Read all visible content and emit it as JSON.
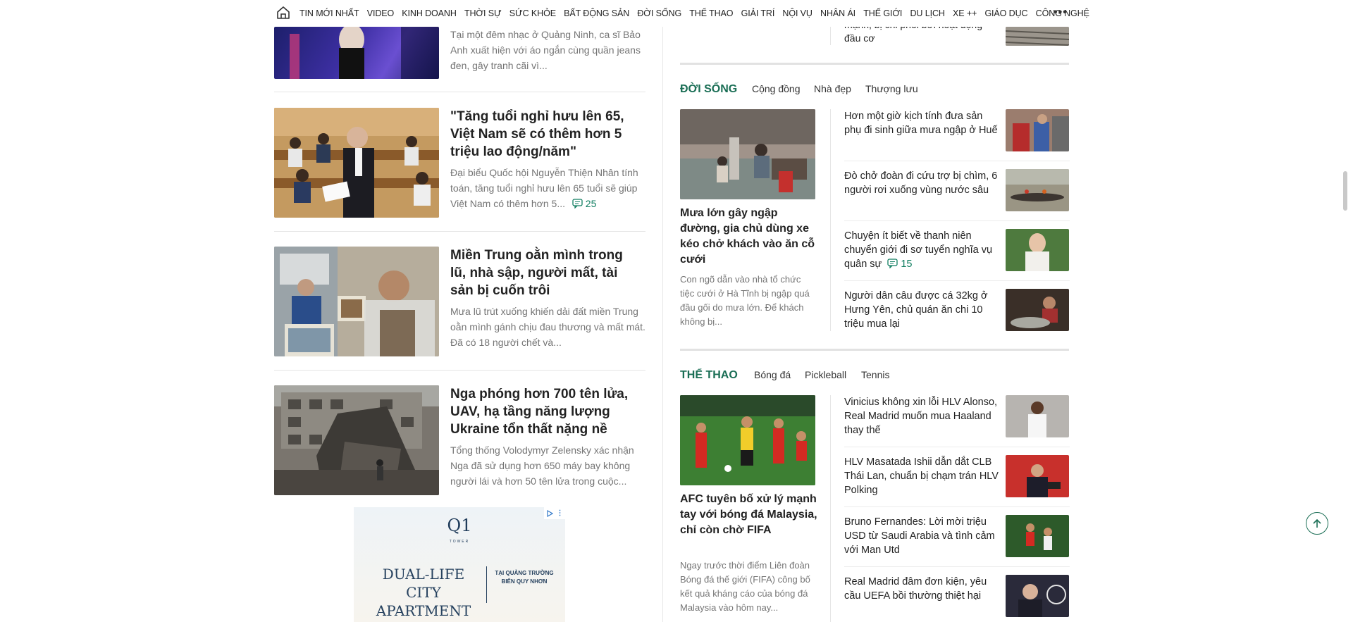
{
  "nav": {
    "items": [
      "TIN MỚI NHẤT",
      "VIDEO",
      "KINH DOANH",
      "THỜI SỰ",
      "SỨC KHỎE",
      "BẤT ĐỘNG SẢN",
      "ĐỜI SỐNG",
      "THỂ THAO",
      "GIẢI TRÍ",
      "NỘI VỤ",
      "NHÂN ÁI",
      "THẾ GIỚI",
      "DU LỊCH",
      "XE ++",
      "GIÁO DỤC",
      "CÔNG NGHỆ"
    ],
    "more": "•••"
  },
  "left": {
    "top_partial_desc": "Tại một đêm nhạc ở Quảng Ninh, ca sĩ Bảo Anh xuất hiện với áo ngắn cùng quần jeans đen, gây tranh cãi vì...",
    "articles": [
      {
        "title": "\"Tăng tuổi nghỉ hưu lên 65, Việt Nam sẽ có thêm hơn 5 triệu lao động/năm\"",
        "desc": "Đại biểu Quốc hội Nguyễn Thiện Nhân tính toán, tăng tuổi nghỉ hưu lên 65 tuổi sẽ giúp Việt Nam có thêm hơn 5...",
        "comments": "25"
      },
      {
        "title": "Miền Trung oằn mình trong lũ, nhà sập, người mất, tài sản bị cuốn trôi",
        "desc": "Mưa lũ trút xuống khiến dải đất miền Trung oằn mình gánh chịu đau thương và mất mát. Đã có 18 người chết và..."
      },
      {
        "title": "Nga phóng hơn 700 tên lửa, UAV, hạ tầng năng lượng Ukraine tổn thất nặng nề",
        "desc": "Tổng thống Volodymyr Zelensky xác nhận Nga đã sử dụng hơn 650 máy bay không người lái và hơn 50 tên lửa trong cuộc..."
      }
    ],
    "ad": {
      "logo": "Q1",
      "logo_sub": "TOWER",
      "headline": "DUAL-LIFE CITY APARTMENT",
      "sub": "TẠI QUẢNG TRƯỜNG BIỂN QUY NHƠN"
    }
  },
  "right": {
    "top_partial_text": "mạnh, bị chỉ phối bởi hoạt động đầu cơ",
    "doi_song": {
      "title": "ĐỜI SỐNG",
      "subs": [
        "Cộng đồng",
        "Nhà đẹp",
        "Thượng lưu"
      ],
      "featured": {
        "title": "Mưa lớn gây ngập đường, gia chủ dùng xe kéo chở khách vào ăn cỗ cưới",
        "desc": "Con ngõ dẫn vào nhà tổ chức tiệc cưới ở Hà Tĩnh bị ngập quá đầu gối do mưa lớn. Để khách không bị..."
      },
      "items": [
        {
          "title": "Hơn một giờ kịch tính đưa sản phụ đi sinh giữa mưa ngập ở Huế"
        },
        {
          "title": "Đò chở đoàn đi cứu trợ bị chìm, 6 người rơi xuống vùng nước sâu"
        },
        {
          "title": "Chuyện ít biết về thanh niên chuyển giới đi sơ tuyển nghĩa vụ quân sự",
          "comments": "15"
        },
        {
          "title": "Người dân câu được cá 32kg ở Hưng Yên, chủ quán ăn chi 10 triệu mua lại"
        }
      ]
    },
    "the_thao": {
      "title": "THỂ THAO",
      "subs": [
        "Bóng đá",
        "Pickleball",
        "Tennis"
      ],
      "featured": {
        "title": "AFC tuyên bố xử lý mạnh tay với bóng đá Malaysia, chỉ còn chờ FIFA",
        "desc": "Ngay trước thời điểm Liên đoàn Bóng đá thế giới (FIFA) công bố kết quả kháng cáo của bóng đá Malaysia vào hôm nay..."
      },
      "items": [
        {
          "title": "Vinicius không xin lỗi HLV Alonso, Real Madrid muốn mua Haaland thay thế"
        },
        {
          "title": "HLV Masatada Ishii dẫn dắt CLB Thái Lan, chuẩn bị chạm trán HLV Polking"
        },
        {
          "title": "Bruno Fernandes: Lời mời triệu USD từ Saudi Arabia và tình cảm với Man Utd"
        },
        {
          "title": "Real Madrid đâm đơn kiện, yêu cầu UEFA bồi thường thiệt hại"
        }
      ]
    }
  },
  "colors": {
    "accent": "#1a6e55",
    "comment": "#117e61",
    "muted_text": "#757575"
  }
}
